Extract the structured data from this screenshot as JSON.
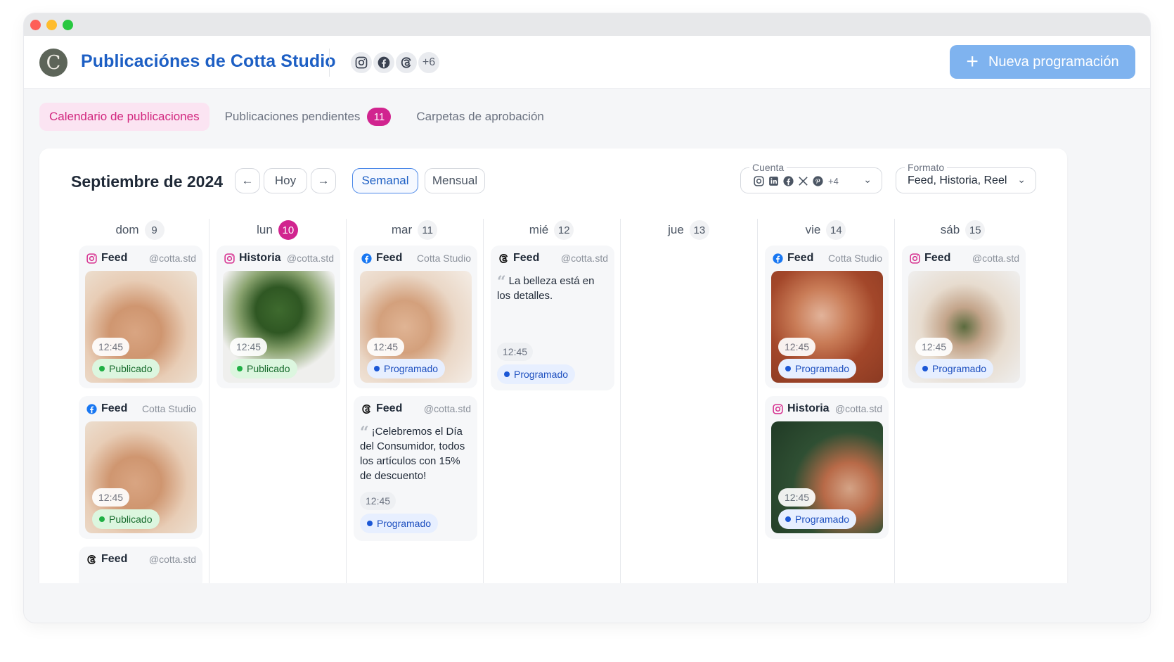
{
  "window": {
    "controls": [
      "close",
      "minimize",
      "maximize"
    ]
  },
  "header": {
    "logo_letter": "C",
    "title": "Publicaciónes de Cotta Studio",
    "social_icons": [
      "instagram-icon",
      "facebook-icon",
      "threads-icon"
    ],
    "social_more": "+6",
    "new_button": "Nueva programación",
    "new_button_icon": "plus-icon"
  },
  "tabs": [
    {
      "label": "Calendario de publicaciones",
      "active": true
    },
    {
      "label": "Publicaciones pendientes",
      "badge": "11"
    },
    {
      "label": "Carpetas de aprobación"
    }
  ],
  "toolbar": {
    "month": "Septiembre de 2024",
    "prev_icon": "arrow-left-icon",
    "today": "Hoy",
    "next_icon": "arrow-right-icon",
    "weekly": "Semanal",
    "monthly": "Mensual",
    "account_label": "Cuenta",
    "account_icons": [
      "instagram-icon",
      "linkedin-icon",
      "facebook-icon",
      "x-icon",
      "pinterest-icon"
    ],
    "account_more": "+4",
    "format_label": "Formato",
    "format_value": "Feed, Historia, Reel"
  },
  "colors": {
    "accent_blue": "#1d5fc4",
    "accent_pink": "#d1248f",
    "button_blue": "#7fb3ef",
    "published_green": "#20b045",
    "scheduled_blue": "#1b57d6"
  },
  "days": [
    {
      "name": "dom",
      "num": "9"
    },
    {
      "name": "lun",
      "num": "10",
      "today": true
    },
    {
      "name": "mar",
      "num": "11"
    },
    {
      "name": "mié",
      "num": "12"
    },
    {
      "name": "jue",
      "num": "13"
    },
    {
      "name": "vie",
      "num": "14"
    },
    {
      "name": "sáb",
      "num": "15"
    }
  ],
  "posts": {
    "dom_1": {
      "network": "instagram",
      "format": "Feed",
      "account": "@cotta.std",
      "time": "12:45",
      "status": "Publicado"
    },
    "dom_2": {
      "network": "facebook",
      "format": "Feed",
      "account": "Cotta Studio",
      "time": "12:45",
      "status": "Publicado"
    },
    "dom_3": {
      "network": "threads",
      "format": "Feed",
      "account": "@cotta.std"
    },
    "lun_1": {
      "network": "instagram",
      "format": "Historia",
      "account": "@cotta.std",
      "time": "12:45",
      "status": "Publicado"
    },
    "mar_1": {
      "network": "facebook",
      "format": "Feed",
      "account": "Cotta Studio",
      "time": "12:45",
      "status": "Programado"
    },
    "mar_2": {
      "network": "threads",
      "format": "Feed",
      "account": "@cotta.std",
      "text": "¡Celebremos el Día del Consumidor, todos los artículos con 15% de descuento!",
      "time": "12:45",
      "status": "Programado"
    },
    "mie_1": {
      "network": "threads",
      "format": "Feed",
      "account": "@cotta.std",
      "text": "La belleza está en los detalles.",
      "time": "12:45",
      "status": "Programado"
    },
    "vie_1": {
      "network": "facebook",
      "format": "Feed",
      "account": "Cotta Studio",
      "time": "12:45",
      "status": "Programado"
    },
    "vie_2": {
      "network": "instagram",
      "format": "Historia",
      "account": "@cotta.std",
      "time": "12:45",
      "status": "Programado"
    },
    "sab_1": {
      "network": "instagram",
      "format": "Feed",
      "account": "@cotta.std",
      "time": "12:45",
      "status": "Programado"
    }
  }
}
